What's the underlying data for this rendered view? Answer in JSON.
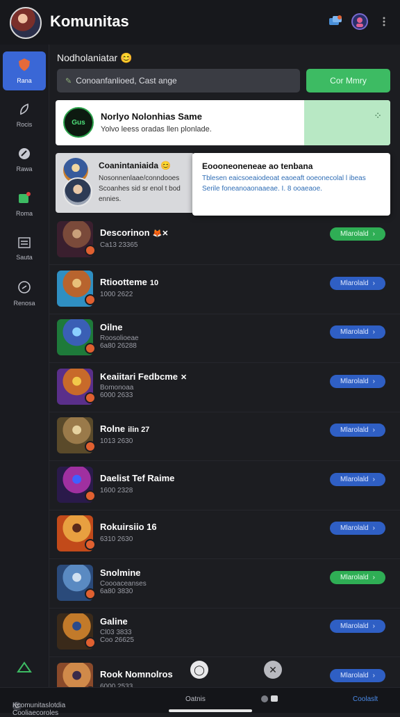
{
  "header": {
    "title": "Komunitas",
    "icons": [
      "chat-bubble-icon",
      "user-avatar-icon",
      "more-vertical-icon"
    ],
    "badge_color": "#e06030"
  },
  "sidebar": {
    "items": [
      {
        "label": "Rana",
        "icon": "shield-icon",
        "active": true
      },
      {
        "label": "Rocis",
        "icon": "leaf-icon",
        "active": false
      },
      {
        "label": "Rawa",
        "icon": "brush-icon",
        "active": false
      },
      {
        "label": "Roma",
        "icon": "flag-icon",
        "active": false
      },
      {
        "label": "Sauta",
        "icon": "list-icon",
        "active": false
      },
      {
        "label": "Renosa",
        "icon": "gear-icon",
        "active": false
      }
    ],
    "bottom_icon": "home-icon"
  },
  "main": {
    "section_title": "Nodholaniatar 😊",
    "search": {
      "value": "Conoanfanlioed, Cast ange"
    },
    "search_button": "Cor Mmry",
    "banner": {
      "logo_text": "Gus",
      "title": "Norlyo Nolonhias Same",
      "subtitle": "Yolvo leess oradas llen plonlade."
    },
    "notification": {
      "title": "Coanintaniaida 😊",
      "lines": [
        "Nosonnenlaae/conndooes",
        "Scoanhes sid sr enol t bod",
        "ennies."
      ]
    },
    "popup": {
      "title": "Eoooneoneneae ao tenbana",
      "lines": [
        "Tblesen eaicsoeaiodeoat eaoeaft ooeonecolal l ibeas",
        "Serile foneanoaonaaeae. I.  8 ooaeaoe."
      ]
    }
  },
  "list": {
    "rows": [
      {
        "name": "Descorinon",
        "tag": "🦊✕",
        "meta": "Ca13 23365",
        "button": "Mlarolald",
        "green": true,
        "colors": [
          "#3a1f2e",
          "#7a4a3a",
          "#c9a07a"
        ]
      },
      {
        "name": "Rtiootteme",
        "tag": "10",
        "meta": "1000 2622",
        "button": "Mlarolald",
        "green": false,
        "colors": [
          "#2f8fc2",
          "#b8642e",
          "#e8c07a"
        ]
      },
      {
        "name": "Oilne",
        "tag": "",
        "meta": "Roosolioeae",
        "meta2": "6a80 26288",
        "button": "Mlarolald",
        "green": false,
        "colors": [
          "#1e7a3a",
          "#3a5fb5",
          "#8ad0ff"
        ]
      },
      {
        "name": "Keaiitari Fedbcme",
        "tag": "✕",
        "meta": "Bomonoaa",
        "meta2": "6000 2633",
        "button": "Mlarolald",
        "green": false,
        "colors": [
          "#5a2f8a",
          "#c86a2a",
          "#f2c84a"
        ]
      },
      {
        "name": "Rolne",
        "tag": "ilin 27",
        "meta": "1013 2630",
        "button": "Mlarolald",
        "green": false,
        "colors": [
          "#5a4a2a",
          "#9a7a4a",
          "#e6d2a0"
        ]
      },
      {
        "name": "Daelist Tef Raime",
        "tag": "",
        "meta": "1600 2328",
        "button": "Mlarolald",
        "green": false,
        "colors": [
          "#2a1a4a",
          "#a030a0",
          "#4060ff"
        ]
      },
      {
        "name": "Rokuirsiio 16",
        "tag": "",
        "meta": "6310 2630",
        "button": "Mlarolald",
        "green": false,
        "colors": [
          "#c24a1a",
          "#e8a040",
          "#5a2a1a"
        ]
      },
      {
        "name": "Snolmine",
        "tag": "",
        "meta": "Coooaceanses",
        "meta2": "6a80 3830",
        "button": "Mlarolald",
        "green": true,
        "colors": [
          "#2a4a7a",
          "#5a8ac2",
          "#d0e0f0"
        ]
      },
      {
        "name": "Galine",
        "tag": "",
        "meta": "Cl03 3833",
        "meta2": "Coo 26625",
        "button": "Mlarolald",
        "green": false,
        "colors": [
          "#3a2a1a",
          "#c27a2a",
          "#2a4a8a"
        ]
      },
      {
        "name": "Rook Nomnolros",
        "tag": "",
        "meta": "6000 2533",
        "button": "Mlarolald",
        "green": false,
        "colors": [
          "#8a4a2a",
          "#d08a4a",
          "#3a2a4a"
        ]
      }
    ]
  },
  "floating": {
    "left_icon": "circle-icon",
    "right_icon": "close-icon"
  },
  "bottom_bar": {
    "left": "Kcomunitaslotdia Cooliaecoroles",
    "center": "Oatnis",
    "right": "Coolaslt"
  }
}
